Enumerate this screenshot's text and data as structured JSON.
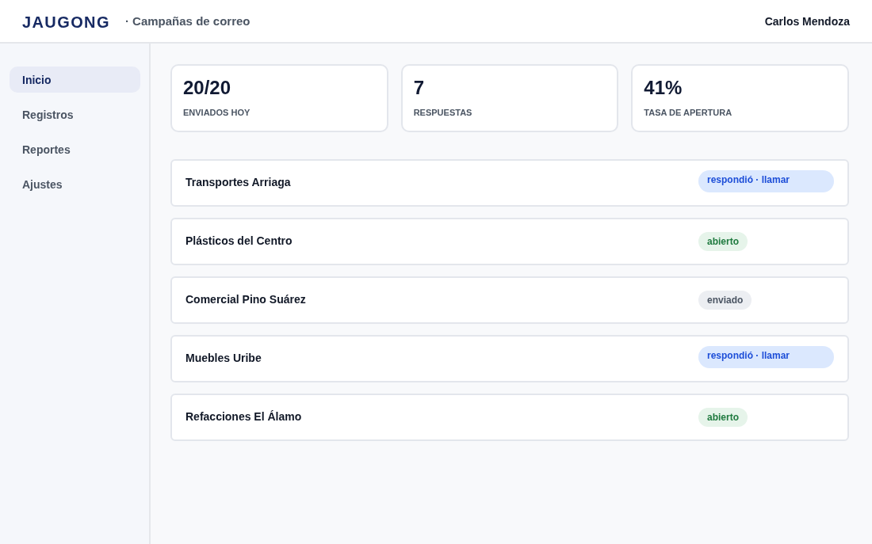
{
  "header": {
    "logo": "JAUGONG",
    "section": "· Campañas de correo",
    "user": "Carlos Mendoza"
  },
  "sidebar": {
    "items": [
      {
        "label": "Inicio",
        "selected": true
      },
      {
        "label": "Registros",
        "selected": false
      },
      {
        "label": "Reportes",
        "selected": false
      },
      {
        "label": "Ajustes",
        "selected": false
      }
    ]
  },
  "stats": [
    {
      "value": "20/20",
      "label": "ENVIADOS HOY"
    },
    {
      "value": "7",
      "label": "RESPUESTAS"
    },
    {
      "value": "41%",
      "label": "TASA DE APERTURA"
    }
  ],
  "contacts": [
    {
      "name": "Transportes Arriaga",
      "status": "respondió · llamar",
      "kind": "replied"
    },
    {
      "name": "Plásticos del Centro",
      "status": "abierto",
      "kind": "opened"
    },
    {
      "name": "Comercial Pino Suárez",
      "status": "enviado",
      "kind": "sent"
    },
    {
      "name": "Muebles Uribe",
      "status": "respondió · llamar",
      "kind": "replied"
    },
    {
      "name": "Refacciones El Álamo",
      "status": "abierto",
      "kind": "opened"
    }
  ]
}
